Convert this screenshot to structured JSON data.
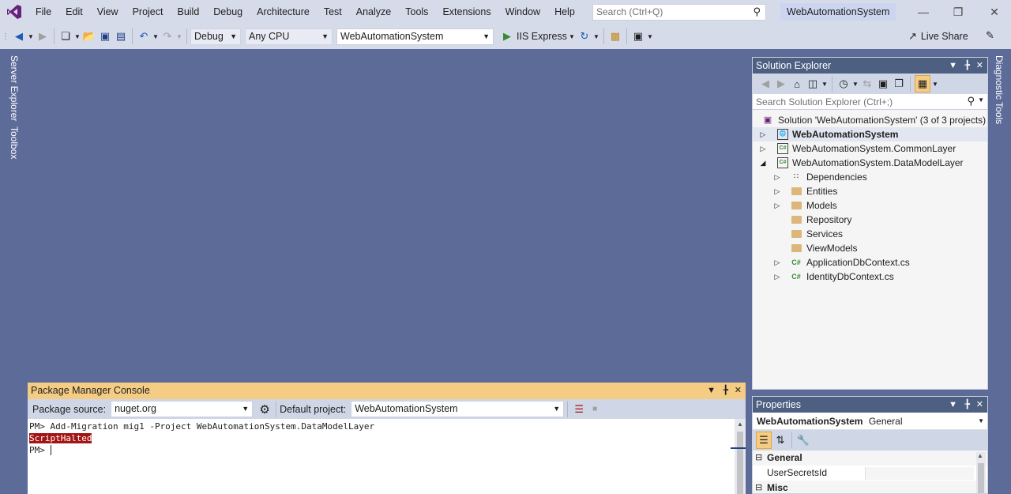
{
  "menubar": {
    "items": [
      "File",
      "Edit",
      "View",
      "Project",
      "Build",
      "Debug",
      "Architecture",
      "Test",
      "Analyze",
      "Tools",
      "Extensions",
      "Window",
      "Help"
    ],
    "search_placeholder": "Search (Ctrl+Q)",
    "solution_name": "WebAutomationSystem"
  },
  "toolbar": {
    "configuration": "Debug",
    "platform": "Any CPU",
    "startup_project": "WebAutomationSystem",
    "run_target": "IIS Express",
    "live_share": "Live Share"
  },
  "left_tabs": [
    "Server Explorer",
    "Toolbox"
  ],
  "right_tabs": [
    "Diagnostic Tools"
  ],
  "solution_explorer": {
    "title": "Solution Explorer",
    "search_placeholder": "Search Solution Explorer (Ctrl+;)",
    "solution_label": "Solution 'WebAutomationSystem' (3 of 3 projects)",
    "nodes": [
      {
        "label": "WebAutomationSystem",
        "bold": true
      },
      {
        "label": "WebAutomationSystem.CommonLayer"
      },
      {
        "label": "WebAutomationSystem.DataModelLayer"
      },
      {
        "label": "Dependencies"
      },
      {
        "label": "Entities"
      },
      {
        "label": "Models"
      },
      {
        "label": "Repository"
      },
      {
        "label": "Services"
      },
      {
        "label": "ViewModels"
      },
      {
        "label": "ApplicationDbContext.cs"
      },
      {
        "label": "IdentityDbContext.cs"
      }
    ]
  },
  "properties": {
    "title": "Properties",
    "object_name": "WebAutomationSystem",
    "object_type": "General",
    "categories": [
      "General",
      "Misc"
    ],
    "rows": [
      {
        "name": "UserSecretsId",
        "value": ""
      }
    ]
  },
  "package_manager": {
    "title": "Package Manager Console",
    "source_label": "Package source:",
    "source_value": "nuget.org",
    "default_project_label": "Default project:",
    "default_project_value": "WebAutomationSystem",
    "lines": [
      "PM> Add-Migration mig1 -Project WebAutomationSystem.DataModelLayer",
      "ScriptHalted",
      "PM> "
    ]
  },
  "colors": {
    "accent": "#5d6b99",
    "panel_head": "#4d6082",
    "console_head": "#f5cc84",
    "error_bg": "#a31515"
  }
}
